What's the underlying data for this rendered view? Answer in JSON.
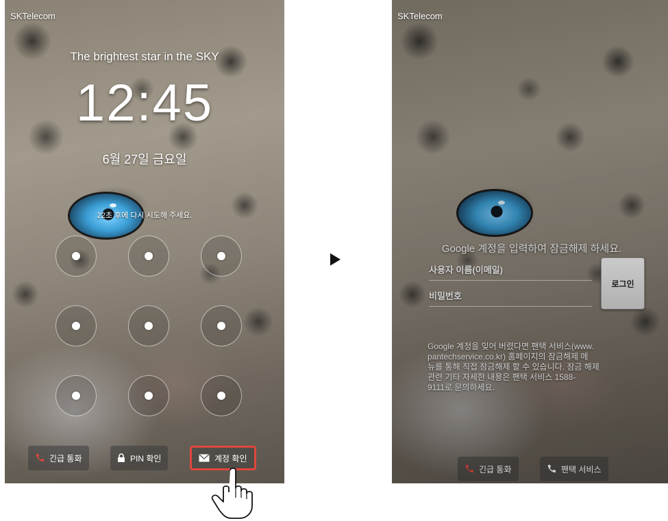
{
  "left_screen": {
    "carrier": "SKTelecom",
    "tagline": "The brightest star in the SKY",
    "time": "12:45",
    "date": "6월 27일 금요일",
    "retry_message": "22초 후에 다시 시도해 주세요.",
    "bottom_buttons": [
      {
        "label": "긴급 통화",
        "icon": "phone-icon"
      },
      {
        "label": "PIN 확인",
        "icon": "lock-icon"
      },
      {
        "label": "계정 확인",
        "icon": "envelope-icon"
      }
    ]
  },
  "right_screen": {
    "carrier": "SKTelecom",
    "login_prompt": "Google 계정을 입력하여 잠금해제 하세요.",
    "username_placeholder": "사용자 이름(이메일)",
    "password_placeholder": "비밀번호",
    "login_button": "로그인",
    "help_text": "Google 계정을 잊어 버렸다면 팬택 서비스(www.\npantechservice.co.kr) 홈페이지의 잠금해제 메\n뉴를 통해 직접 잠금해제 할 수 있습니다. 잠금 해제\n관련 기타 자세한 내용은 팬택 서비스 1588-\n9111로 문의하세요.",
    "bottom_buttons": [
      {
        "label": "긴급 통화",
        "icon": "phone-icon"
      },
      {
        "label": "팬택 서비스",
        "icon": "phone-icon"
      }
    ]
  },
  "colors": {
    "highlight": "#e0473c",
    "phone_icon": "#e0473c",
    "eye": "#3b9fd6"
  },
  "icons": {
    "transition": "right-arrow-icon",
    "pointer": "hand-pointer-icon"
  }
}
